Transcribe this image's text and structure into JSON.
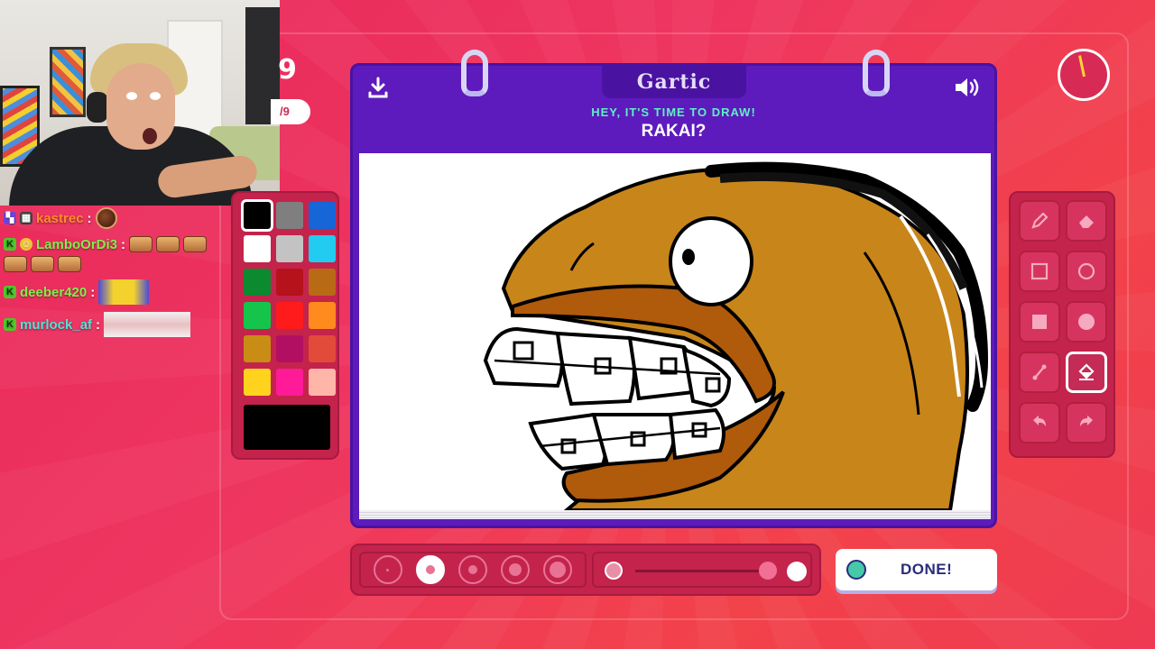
{
  "game": {
    "logo": "Gartic",
    "prompt_heading": "HEY, IT'S TIME TO DRAW!",
    "prompt_word": "RAKAI?",
    "round_number": "9",
    "round_total": "/9",
    "done_label": "DONE!"
  },
  "chat": [
    {
      "user": "kastrec",
      "color": "#ff8c2a"
    },
    {
      "user": "LamboOrDi3",
      "color": "#7cf04a"
    },
    {
      "user": "deeber420",
      "color": "#7cf04a"
    },
    {
      "user": "murlock_af",
      "color": "#4fe3d8"
    }
  ],
  "palette": {
    "colors": [
      "#000000",
      "#7f7f7f",
      "#1766d8",
      "#ffffff",
      "#c3c3c3",
      "#22cbf0",
      "#0b8a2f",
      "#b5121b",
      "#b96a14",
      "#15c44b",
      "#ff1b1b",
      "#ff8a1e",
      "#c98d15",
      "#b30f62",
      "#e24b3a",
      "#ffd21e",
      "#ff1a98",
      "#ffb5a8"
    ],
    "current": "#000000"
  },
  "tools": [
    "pencil-icon",
    "eraser-icon",
    "rectangle-outline-icon",
    "circle-outline-icon",
    "rectangle-fill-icon",
    "circle-fill-icon",
    "line-icon",
    "fill-bucket-icon",
    "undo-icon",
    "redo-icon"
  ],
  "active_tool": "fill-bucket-icon",
  "brush_sizes": {
    "count": 5,
    "selected_index": 1
  },
  "opacity": {
    "value": 0.95
  }
}
